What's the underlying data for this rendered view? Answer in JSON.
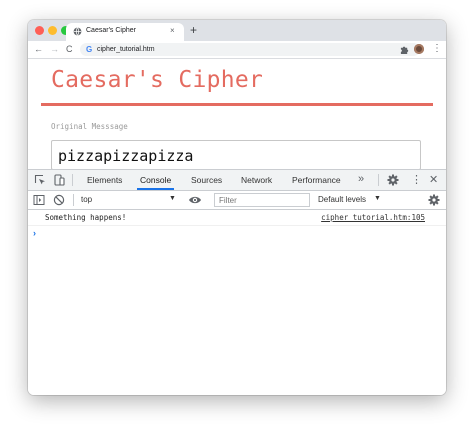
{
  "browser": {
    "tab": {
      "title": "Caesar's Cipher",
      "close_glyph": "×"
    },
    "new_tab_glyph": "+",
    "nav": {
      "back_glyph": "←",
      "forward_glyph": "→",
      "reload_glyph": "C"
    },
    "address": {
      "url": "cipher_tutorial.htm",
      "site_icon": "G"
    },
    "menu_glyph": "⋮",
    "icons": [
      "globe-icon",
      "puzzle-extensions-icon",
      "profile-avatar"
    ]
  },
  "page": {
    "title": "Caesar's Cipher",
    "field_label": "Original Messsage",
    "message_value": "pizzapizzapizza",
    "accent_color": "#e46b60"
  },
  "devtools": {
    "tabs": [
      {
        "label": "Elements",
        "active": false
      },
      {
        "label": "Console",
        "active": true
      },
      {
        "label": "Sources",
        "active": false
      },
      {
        "label": "Network",
        "active": false
      },
      {
        "label": "Performance",
        "active": false
      }
    ],
    "more_tabs_glyph": "»",
    "menu_glyph": "⋮",
    "close_glyph": "✕",
    "console_toolbar": {
      "context": "top",
      "context_arrow": "▼",
      "filter_placeholder": "Filter",
      "levels": "Default levels",
      "levels_arrow": "▼"
    },
    "messages": [
      {
        "text": "Something happens!",
        "source": "cipher_tutorial.htm:105"
      }
    ],
    "prompt_glyph": "›",
    "accent_color": "#1a73e8"
  }
}
